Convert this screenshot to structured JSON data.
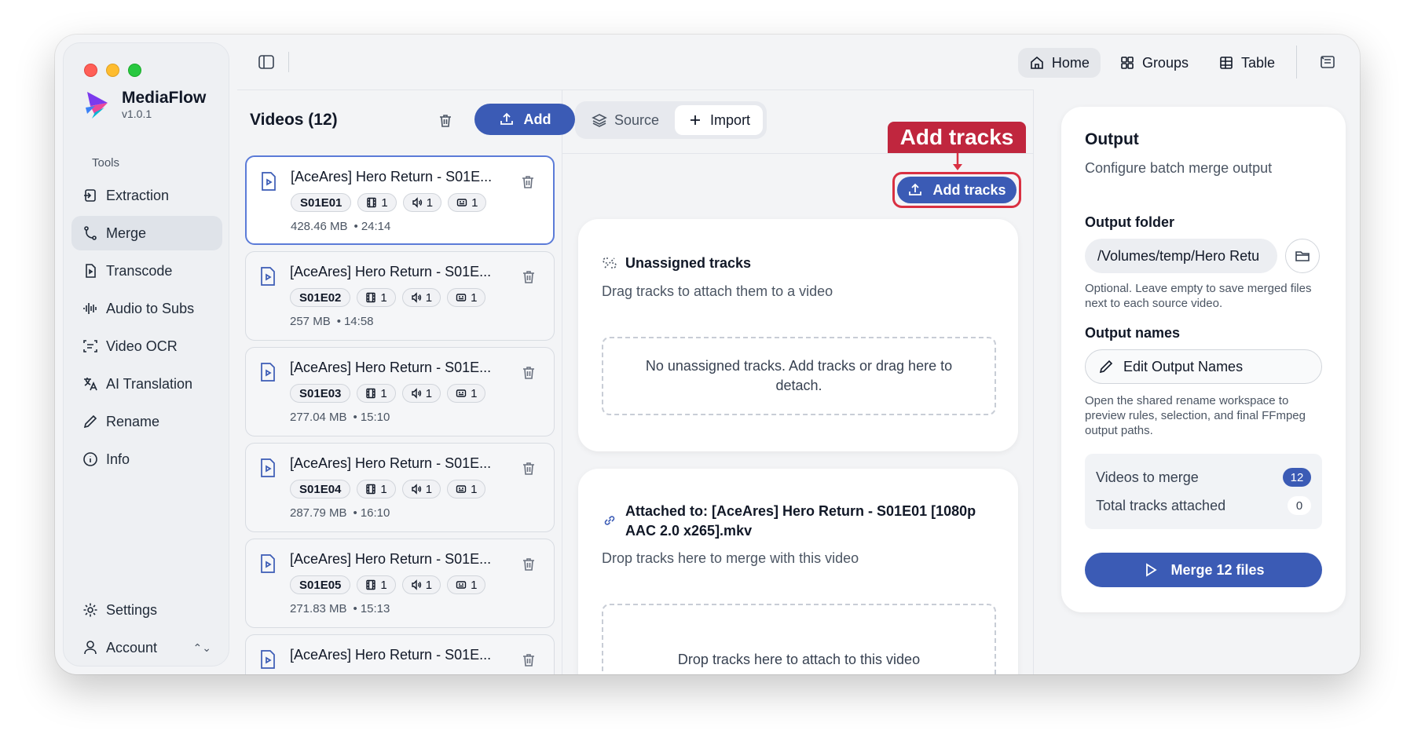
{
  "app": {
    "name": "MediaFlow",
    "version": "v1.0.1"
  },
  "sidebar": {
    "section_label": "Tools",
    "items": [
      {
        "label": "Extraction",
        "icon": "extraction-icon"
      },
      {
        "label": "Merge",
        "icon": "merge-icon",
        "active": true
      },
      {
        "label": "Transcode",
        "icon": "transcode-icon"
      },
      {
        "label": "Audio to Subs",
        "icon": "audio-waveform-icon"
      },
      {
        "label": "Video OCR",
        "icon": "ocr-scan-icon"
      },
      {
        "label": "AI Translation",
        "icon": "translate-icon"
      },
      {
        "label": "Rename",
        "icon": "pencil-icon"
      },
      {
        "label": "Info",
        "icon": "info-icon"
      }
    ],
    "settings_label": "Settings",
    "account_label": "Account"
  },
  "topnav": {
    "home": "Home",
    "groups": "Groups",
    "table": "Table"
  },
  "videos": {
    "title": "Videos (12)",
    "add_label": "Add",
    "items": [
      {
        "title": "[AceAres] Hero Return - S01E...",
        "ep": "S01E01",
        "video": "1",
        "audio": "1",
        "subs": "1",
        "size": "428.46 MB",
        "duration": "24:14"
      },
      {
        "title": "[AceAres] Hero Return - S01E...",
        "ep": "S01E02",
        "video": "1",
        "audio": "1",
        "subs": "1",
        "size": "257 MB",
        "duration": "14:58"
      },
      {
        "title": "[AceAres] Hero Return - S01E...",
        "ep": "S01E03",
        "video": "1",
        "audio": "1",
        "subs": "1",
        "size": "277.04 MB",
        "duration": "15:10"
      },
      {
        "title": "[AceAres] Hero Return - S01E...",
        "ep": "S01E04",
        "video": "1",
        "audio": "1",
        "subs": "1",
        "size": "287.79 MB",
        "duration": "16:10"
      },
      {
        "title": "[AceAres] Hero Return - S01E...",
        "ep": "S01E05",
        "video": "1",
        "audio": "1",
        "subs": "1",
        "size": "271.83 MB",
        "duration": "15:13"
      },
      {
        "title": "[AceAres] Hero Return - S01E..."
      }
    ]
  },
  "middle": {
    "tab_source": "Source",
    "tab_import": "Import",
    "annotation": "Add tracks",
    "add_tracks_label": "Add tracks",
    "unassigned_title": "Unassigned tracks",
    "unassigned_sub": "Drag tracks to attach them to a video",
    "unassigned_empty": "No unassigned tracks. Add tracks or drag here to detach.",
    "attached_title": "Attached to: [AceAres] Hero Return - S01E01 [1080p AAC 2.0 x265].mkv",
    "attached_sub": "Drop tracks here to merge with this video",
    "attached_drop": "Drop tracks here to attach to this video"
  },
  "output": {
    "title": "Output",
    "subtitle": "Configure batch merge output",
    "folder_label": "Output folder",
    "folder_value": "/Volumes/temp/Hero Retu",
    "folder_help": "Optional. Leave empty to save merged files next to each source video.",
    "names_label": "Output names",
    "edit_names_label": "Edit Output Names",
    "names_help": "Open the shared rename workspace to preview rules, selection, and final FFmpeg output paths.",
    "videos_to_merge_label": "Videos to merge",
    "videos_to_merge_count": "12",
    "tracks_attached_label": "Total tracks attached",
    "tracks_attached_count": "0",
    "merge_label": "Merge 12 files"
  },
  "colors": {
    "accent": "#3b5bb5",
    "annotation": "#c0263e"
  }
}
